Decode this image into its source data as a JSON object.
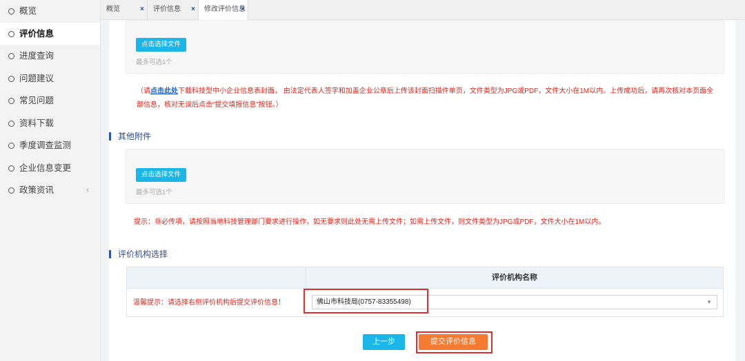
{
  "sidebar": {
    "items": [
      {
        "label": "概览"
      },
      {
        "label": "评价信息"
      },
      {
        "label": "进度查询"
      },
      {
        "label": "问题建议"
      },
      {
        "label": "常见问题"
      },
      {
        "label": "资料下载"
      },
      {
        "label": "季度调查监测"
      },
      {
        "label": "企业信息变更"
      },
      {
        "label": "政策资讯"
      }
    ],
    "expand_glyph": "‹"
  },
  "tabs": [
    {
      "label": "概览"
    },
    {
      "label": "评价信息"
    },
    {
      "label": "修改评价信息"
    }
  ],
  "tab_close_glyph": "×",
  "upload_cover": {
    "button_label": "点击选择文件",
    "limit_hint": "最多可选1个",
    "note_prefix": "（请",
    "note_link": "点击此处",
    "note_line1_rest": "下载科技型中小企业信息表封面， 由法定代表人签字和加盖企业公章后上传该封面扫描件单页，文件类型为JPG或PDF，文件大小在1M以内。上传成功后，请再次核对本页面全",
    "note_line2": "部信息，核对无误后点击“提交填报信息”按钮。）"
  },
  "other_attachments": {
    "title": "其他附件",
    "button_label": "点击选择文件",
    "limit_hint": "最多可选1个",
    "note": "提示：非必传项，请按照当地科技管理部门要求进行操作，如无要求则此处无需上传文件；如需上传文件，则文件类型为JPG或PDF，文件大小在1M以内。"
  },
  "org_selection": {
    "title": "评价机构选择",
    "column_header": "评价机构名称",
    "tip": "温馨提示：请选择右侧评价机构后提交评价信息！",
    "selected_value": "佛山市科技局(0757-83355498)",
    "caret": "▼"
  },
  "actions": {
    "prev_label": "上一步",
    "submit_label": "提交评价信息"
  },
  "colors": {
    "accent_blue": "#1ab6e8",
    "submit_orange": "#f57a32",
    "warning_red": "#e0261c",
    "highlight_red": "#e32c2c"
  }
}
